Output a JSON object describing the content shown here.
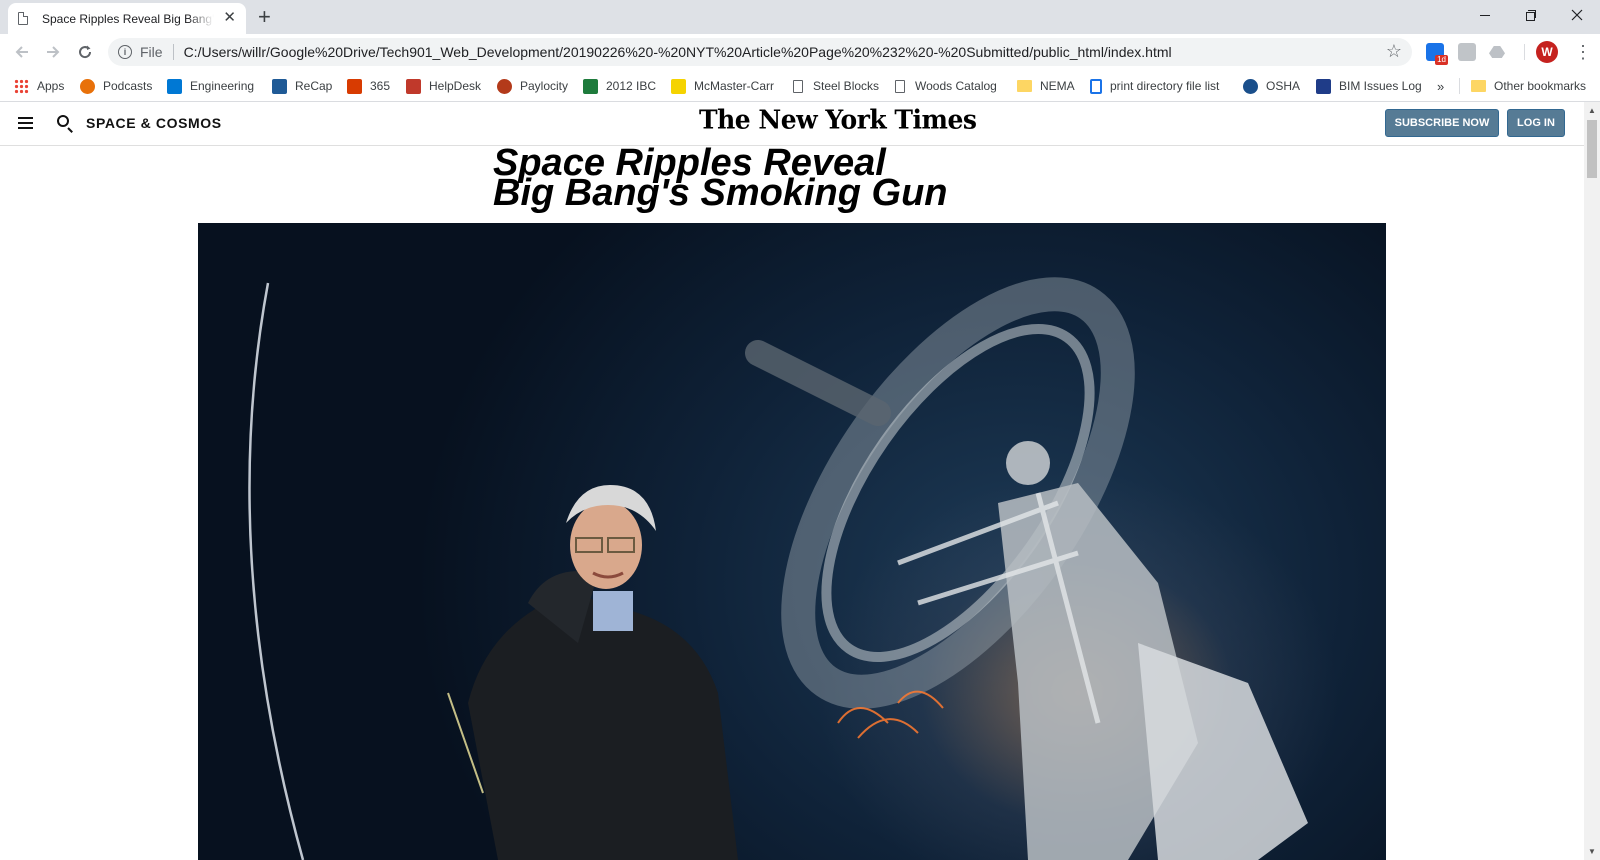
{
  "browser": {
    "tab_title": "Space Ripples Reveal Big Bang's Smoking Gun",
    "tab_close": "✕",
    "new_tab": "+",
    "scheme_label": "File",
    "url": "C:/Users/willr/Google%20Drive/Tech901_Web_Development/20190226%20-%20NYT%20Article%20Page%20%232%20-%20Submitted/public_html/index.html",
    "extension_badge": "1d",
    "profile_initial": "W",
    "bookmarks": [
      {
        "label": "Apps",
        "icon": "apps-grid-icon"
      },
      {
        "label": "Podcasts",
        "icon": "podcasts-icon",
        "color": "#e8710a"
      },
      {
        "label": "Engineering",
        "icon": "sharepoint-icon",
        "color": "#0078d4"
      },
      {
        "label": "ReCap",
        "icon": "recap-icon",
        "color": "#1f5a96"
      },
      {
        "label": "365",
        "icon": "office-365-icon",
        "color": "#d83b01"
      },
      {
        "label": "HelpDesk",
        "icon": "helpdesk-icon",
        "color": "#c0392b"
      },
      {
        "label": "Paylocity",
        "icon": "paylocity-icon",
        "color": "#b33a1a"
      },
      {
        "label": "2012 IBC",
        "icon": "ibc-icon",
        "color": "#1e7b3c"
      },
      {
        "label": "McMaster-Carr",
        "icon": "mcmaster-icon",
        "color": "#f5d300"
      },
      {
        "label": "Steel Blocks",
        "icon": "page-icon"
      },
      {
        "label": "Woods Catalog",
        "icon": "page-icon"
      },
      {
        "label": "NEMA",
        "icon": "folder-icon"
      },
      {
        "label": "print directory file list",
        "icon": "bracket-icon",
        "color": "#1a73e8"
      },
      {
        "label": "OSHA",
        "icon": "osha-icon",
        "color": "#1a4f8b"
      },
      {
        "label": "BIM Issues Log",
        "icon": "bim-icon",
        "color": "#1f3c88"
      }
    ],
    "bookmarks_overflow": "»",
    "other_bookmarks": "Other bookmarks"
  },
  "page": {
    "section": "SPACE & COSMOS",
    "logo": "The New York Times",
    "subscribe_label": "SUBSCRIBE NOW",
    "login_label": "LOG IN",
    "headline_line1": "Space Ripples Reveal",
    "headline_line2": "Big Bang's Smoking Gun",
    "hero_image": "photo of a scientist in a dark jacket standing beside a large radio telescope at night"
  },
  "colors": {
    "button_bg": "#567b95",
    "tabstrip_bg": "#dee1e6",
    "omnibox_bg": "#f1f3f4"
  }
}
